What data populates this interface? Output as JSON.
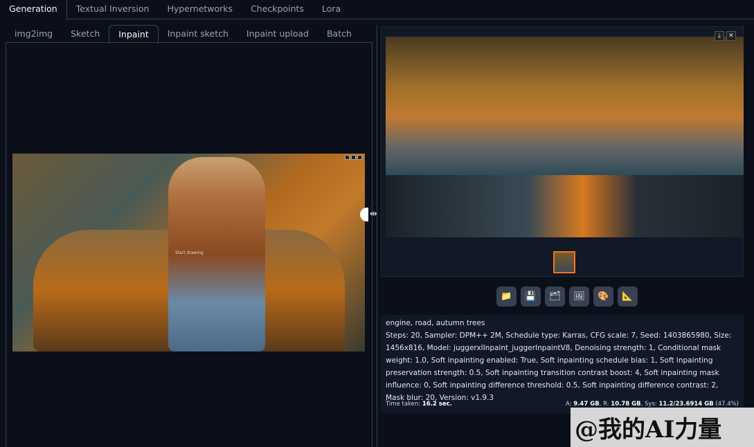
{
  "top_tabs": [
    "Generation",
    "Textual Inversion",
    "Hypernetworks",
    "Checkpoints",
    "Lora"
  ],
  "sub_tabs": [
    "img2img",
    "Sketch",
    "Inpaint",
    "Inpaint sketch",
    "Inpaint upload",
    "Batch"
  ],
  "active_top_tab": "Generation",
  "active_sub_tab": "Inpaint",
  "canvas": {
    "hint": "Start drawing"
  },
  "gallery": {
    "download": "⤓",
    "close": "✕"
  },
  "actions": [
    {
      "icon": "folder-icon",
      "glyph": "📁"
    },
    {
      "icon": "save-icon",
      "glyph": "💾"
    },
    {
      "icon": "zip-icon",
      "glyph": "🗂"
    },
    {
      "icon": "send-to-img2img-icon",
      "glyph": "🖼"
    },
    {
      "icon": "send-to-inpaint-icon",
      "glyph": "🎨"
    },
    {
      "icon": "send-to-extras-icon",
      "glyph": "📐"
    }
  ],
  "info": {
    "prompt": "engine, road, autumn trees",
    "params": "Steps: 20, Sampler: DPM++ 2M, Schedule type: Karras, CFG scale: 7, Seed: 1403865980, Size: 1456x816, Model: juggerxlInpaint_juggerInpaintV8, Denoising strength: 1, Conditional mask weight: 1.0, Soft inpainting enabled: True, Soft inpainting schedule bias: 1, Soft inpainting preservation strength: 0.5, Soft inpainting transition contrast boost: 4, Soft inpainting mask influence: 0, Soft inpainting difference threshold: 0.5, Soft inpainting difference contrast: 2, Mask blur: 20, Version: v1.9.3",
    "time_label": "Time taken:",
    "time_value": "16.2 sec.",
    "mem_a_label": "A:",
    "mem_a": "9.47 GB",
    "mem_r_label": "R:",
    "mem_r": "10.78 GB",
    "mem_sys_label": "Sys:",
    "mem_sys": "11.2/23.6914 GB",
    "mem_pct": "(47.4%)"
  },
  "watermark": "@我的AI力量",
  "accent": "#f97316"
}
